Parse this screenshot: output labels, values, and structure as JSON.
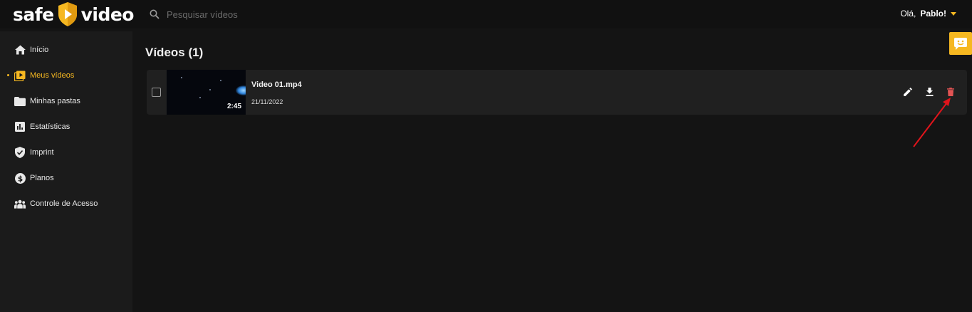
{
  "header": {
    "logo": {
      "left": "safe",
      "right": "video"
    },
    "search_placeholder": "Pesquisar vídeos",
    "user": {
      "greeting": "Olá,",
      "name": "Pablo!"
    }
  },
  "sidebar": {
    "items": [
      {
        "label": "Início",
        "icon": "home-icon"
      },
      {
        "label": "Meus vídeos",
        "icon": "video-library-icon",
        "active": true
      },
      {
        "label": "Minhas pastas",
        "icon": "folder-icon"
      },
      {
        "label": "Estatísticas",
        "icon": "bar-chart-icon"
      },
      {
        "label": "Imprint",
        "icon": "shield-check-icon"
      },
      {
        "label": "Planos",
        "icon": "dollar-icon"
      },
      {
        "label": "Controle de Acesso",
        "icon": "people-icon"
      }
    ]
  },
  "main": {
    "title": "Vídeos (1)",
    "videos": [
      {
        "name": "Video 01.mp4",
        "date": "21/11/2022",
        "duration": "2:45"
      }
    ]
  },
  "colors": {
    "accent": "#f6b821",
    "delete": "#e25454",
    "annotation": "#e0141b",
    "background": "#141414",
    "sidebar": "#1b1b1b",
    "row": "#202020"
  }
}
